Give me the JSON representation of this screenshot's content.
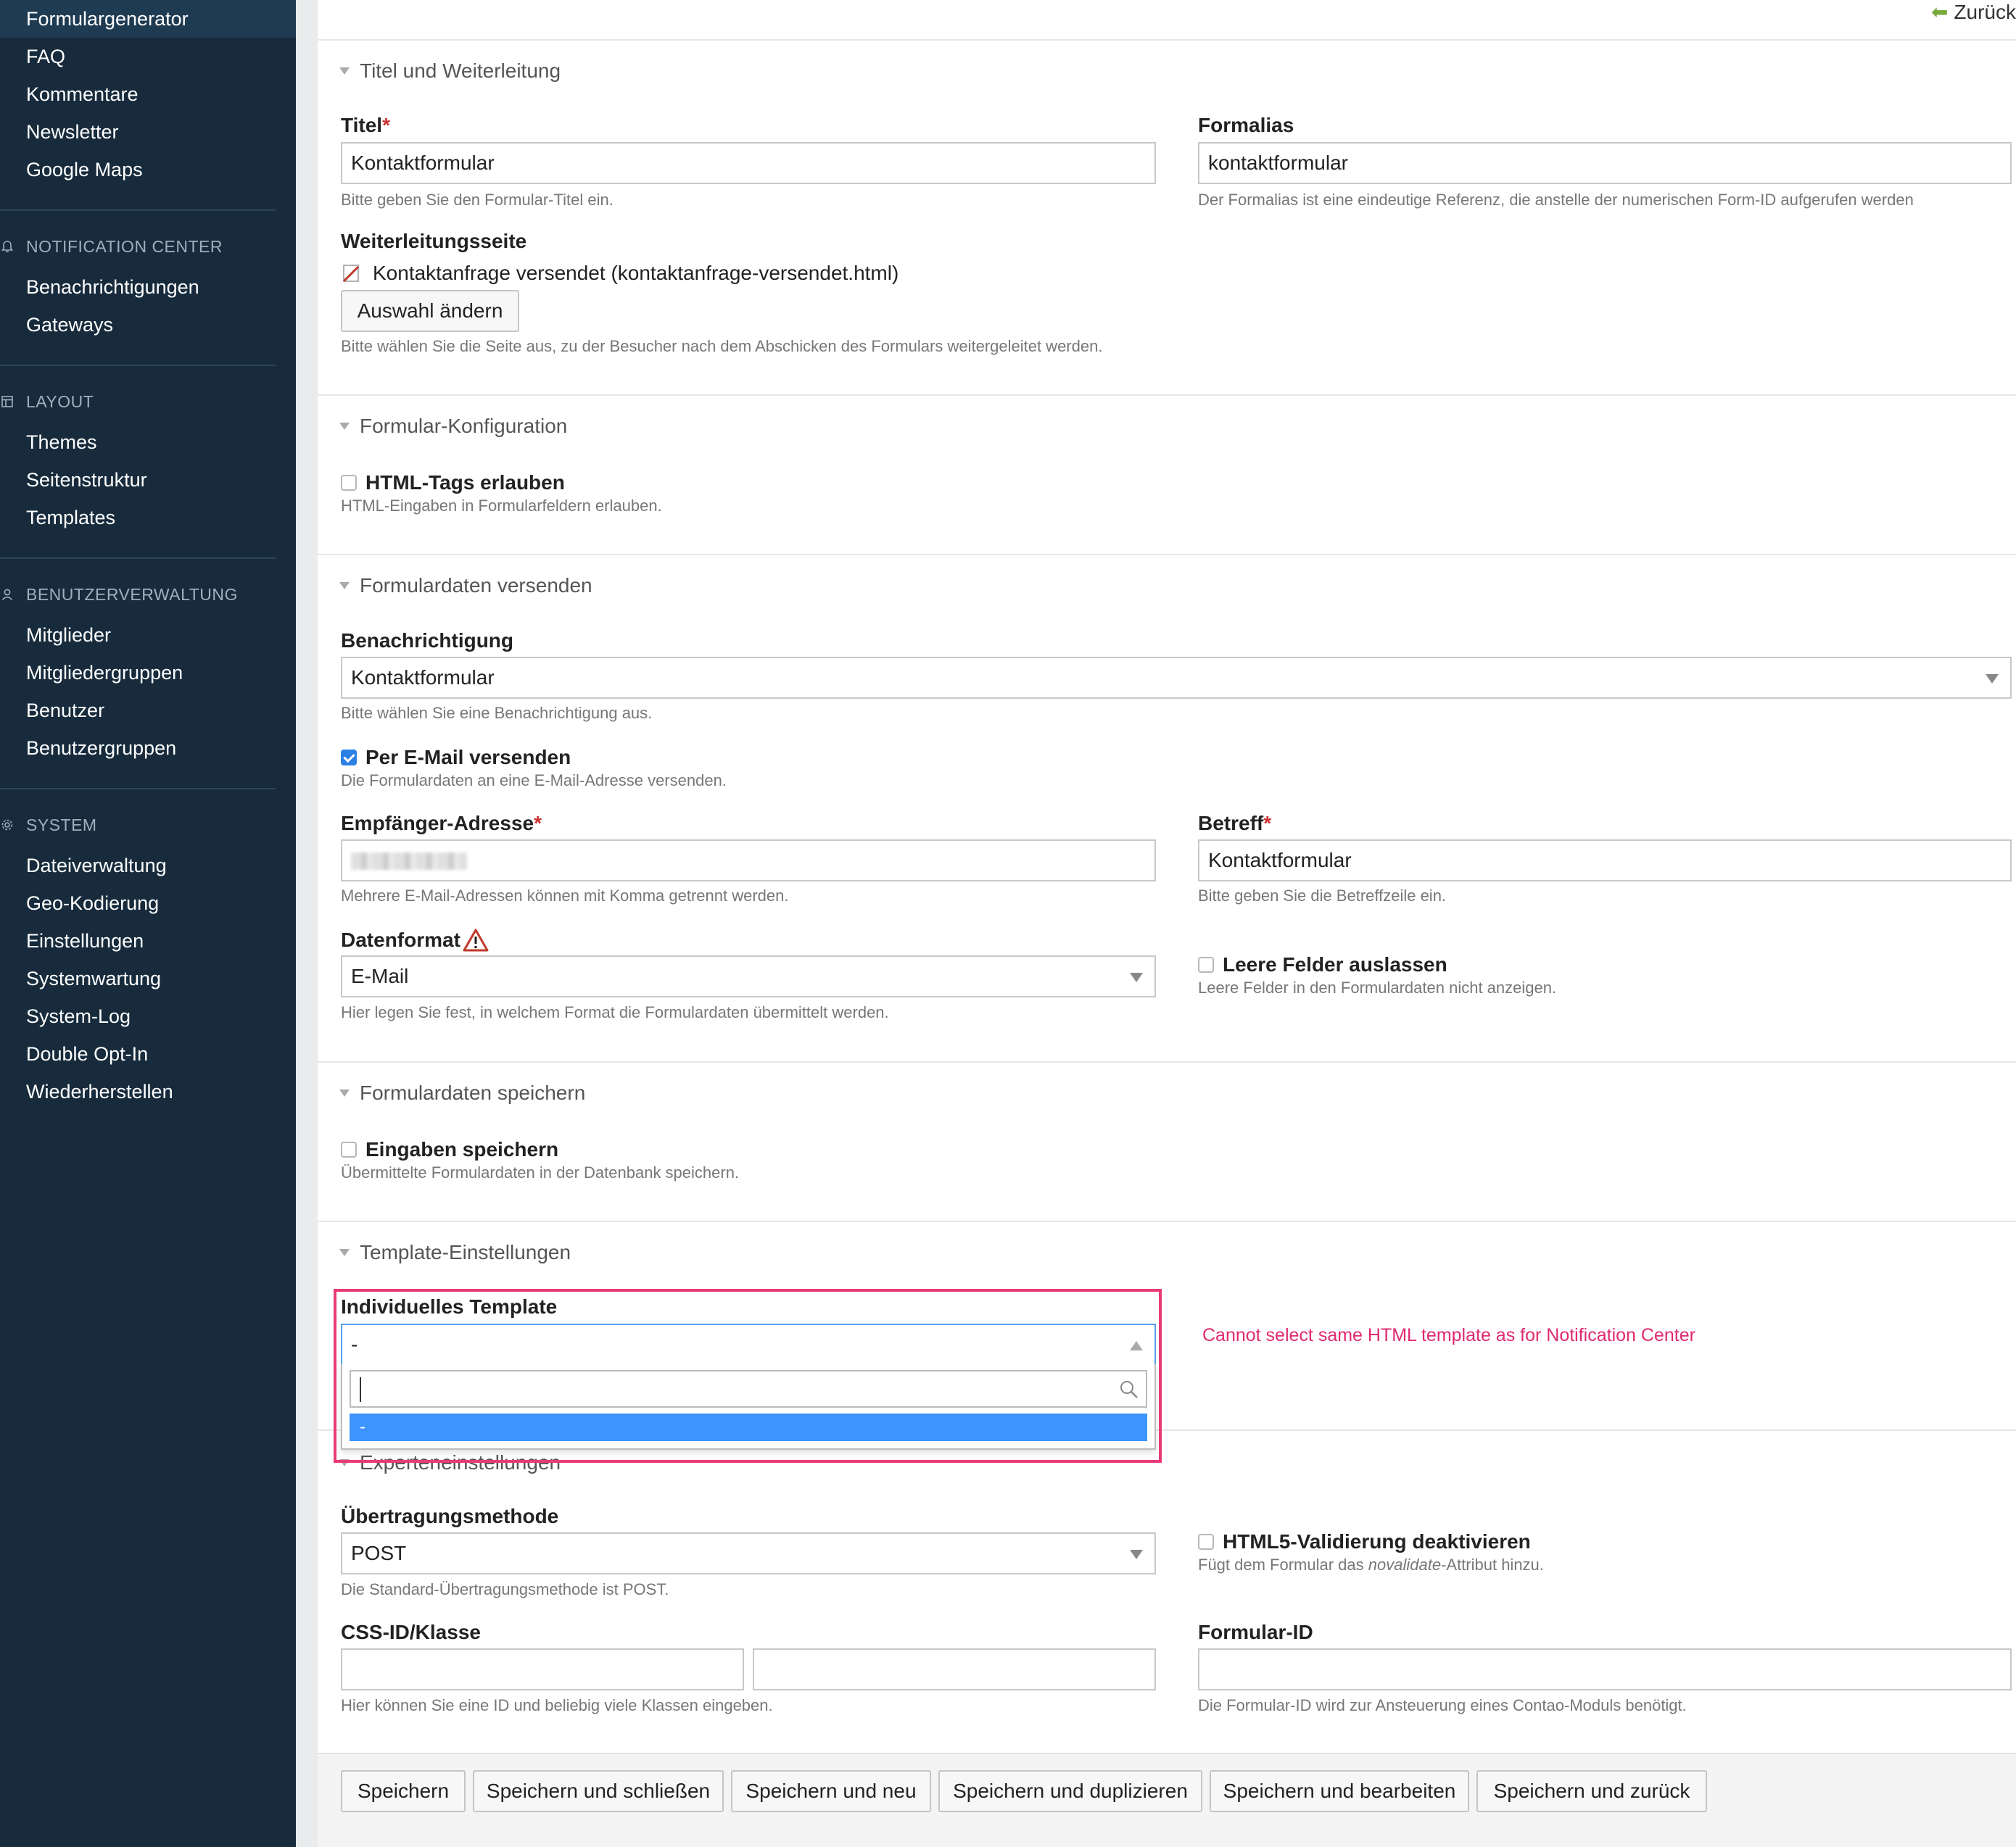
{
  "sidebar": {
    "top_items": [
      {
        "label": "Formulargenerator",
        "active": true
      },
      {
        "label": "FAQ"
      },
      {
        "label": "Kommentare"
      },
      {
        "label": "Newsletter"
      },
      {
        "label": "Google Maps"
      }
    ],
    "groups": [
      {
        "title": "NOTIFICATION CENTER",
        "icon": "bell-icon",
        "items": [
          "Benachrichtigungen",
          "Gateways"
        ]
      },
      {
        "title": "LAYOUT",
        "icon": "layout-icon",
        "items": [
          "Themes",
          "Seitenstruktur",
          "Templates"
        ]
      },
      {
        "title": "BENUTZERVERWALTUNG",
        "icon": "user-icon",
        "items": [
          "Mitglieder",
          "Mitgliedergruppen",
          "Benutzer",
          "Benutzergruppen"
        ]
      },
      {
        "title": "SYSTEM",
        "icon": "gear-icon",
        "items": [
          "Dateiverwaltung",
          "Geo-Kodierung",
          "Einstellungen",
          "Systemwartung",
          "System-Log",
          "Double Opt-In",
          "Wiederherstellen"
        ]
      }
    ]
  },
  "header": {
    "back_label": "Zurück"
  },
  "sections": {
    "titel": {
      "legend": "Titel und Weiterleitung",
      "title_label": "Titel",
      "title_value": "Kontaktformular",
      "title_help": "Bitte geben Sie den Formular-Titel ein.",
      "alias_label": "Formalias",
      "alias_value": "kontaktformular",
      "alias_help": "Der Formalias ist eine eindeutige Referenz, die anstelle der numerischen Form-ID aufgerufen werden",
      "redirect_label": "Weiterleitungsseite",
      "redirect_page": "Kontaktanfrage versendet (kontaktanfrage-versendet.html)",
      "redirect_button": "Auswahl ändern",
      "redirect_help": "Bitte wählen Sie die Seite aus, zu der Besucher nach dem Abschicken des Formulars weitergeleitet werden."
    },
    "konfig": {
      "legend": "Formular-Konfiguration",
      "html_label": "HTML-Tags erlauben",
      "html_help": "HTML-Eingaben in Formularfeldern erlauben."
    },
    "versenden": {
      "legend": "Formulardaten versenden",
      "notification_label": "Benachrichtigung",
      "notification_value": "Kontaktformular",
      "notification_help": "Bitte wählen Sie eine Benachrichtigung aus.",
      "email_label": "Per E-Mail versenden",
      "email_help": "Die Formulardaten an eine E-Mail-Adresse versenden.",
      "recipient_label": "Empfänger-Adresse",
      "recipient_help": "Mehrere E-Mail-Adressen können mit Komma getrennt werden.",
      "subject_label": "Betreff",
      "subject_value": "Kontaktformular",
      "subject_help": "Bitte geben Sie die Betreffzeile ein.",
      "format_label": "Datenformat",
      "format_value": "E-Mail",
      "format_help": "Hier legen Sie fest, in welchem Format die Formulardaten übermittelt werden.",
      "skip_label": "Leere Felder auslassen",
      "skip_help": "Leere Felder in den Formulardaten nicht anzeigen."
    },
    "speichern": {
      "legend": "Formulardaten speichern",
      "store_label": "Eingaben speichern",
      "store_help": "Übermittelte Formulardaten in der Datenbank speichern."
    },
    "template": {
      "legend": "Template-Einstellungen",
      "custom_label": "Individuelles Template",
      "custom_value": "-",
      "dropdown_option": "-",
      "error": "Cannot select same HTML template as for Notification Center"
    },
    "experten": {
      "legend": "Experteneinstellungen",
      "method_label": "Übertragungsmethode",
      "method_value": "POST",
      "method_help": "Die Standard-Übertragungsmethode ist POST.",
      "novalidate_label": "HTML5-Validierung deaktivieren",
      "novalidate_help_pre": "Fügt dem Formular das ",
      "novalidate_help_em": "novalidate",
      "novalidate_help_post": "-Attribut hinzu.",
      "css_label": "CSS-ID/Klasse",
      "css_help": "Hier können Sie eine ID und beliebig viele Klassen eingeben.",
      "formid_label": "Formular-ID",
      "formid_help": "Die Formular-ID wird zur Ansteuerung eines Contao-Moduls benötigt."
    }
  },
  "buttons": [
    "Speichern",
    "Speichern und schließen",
    "Speichern und neu",
    "Speichern und duplizieren",
    "Speichern und bearbeiten",
    "Speichern und zurück"
  ],
  "colors": {
    "sidebar_bg": "#172b3c",
    "accent_blue": "#2c80e4",
    "highlight_pink": "#e83a78",
    "back_arrow_green": "#79a93e"
  }
}
